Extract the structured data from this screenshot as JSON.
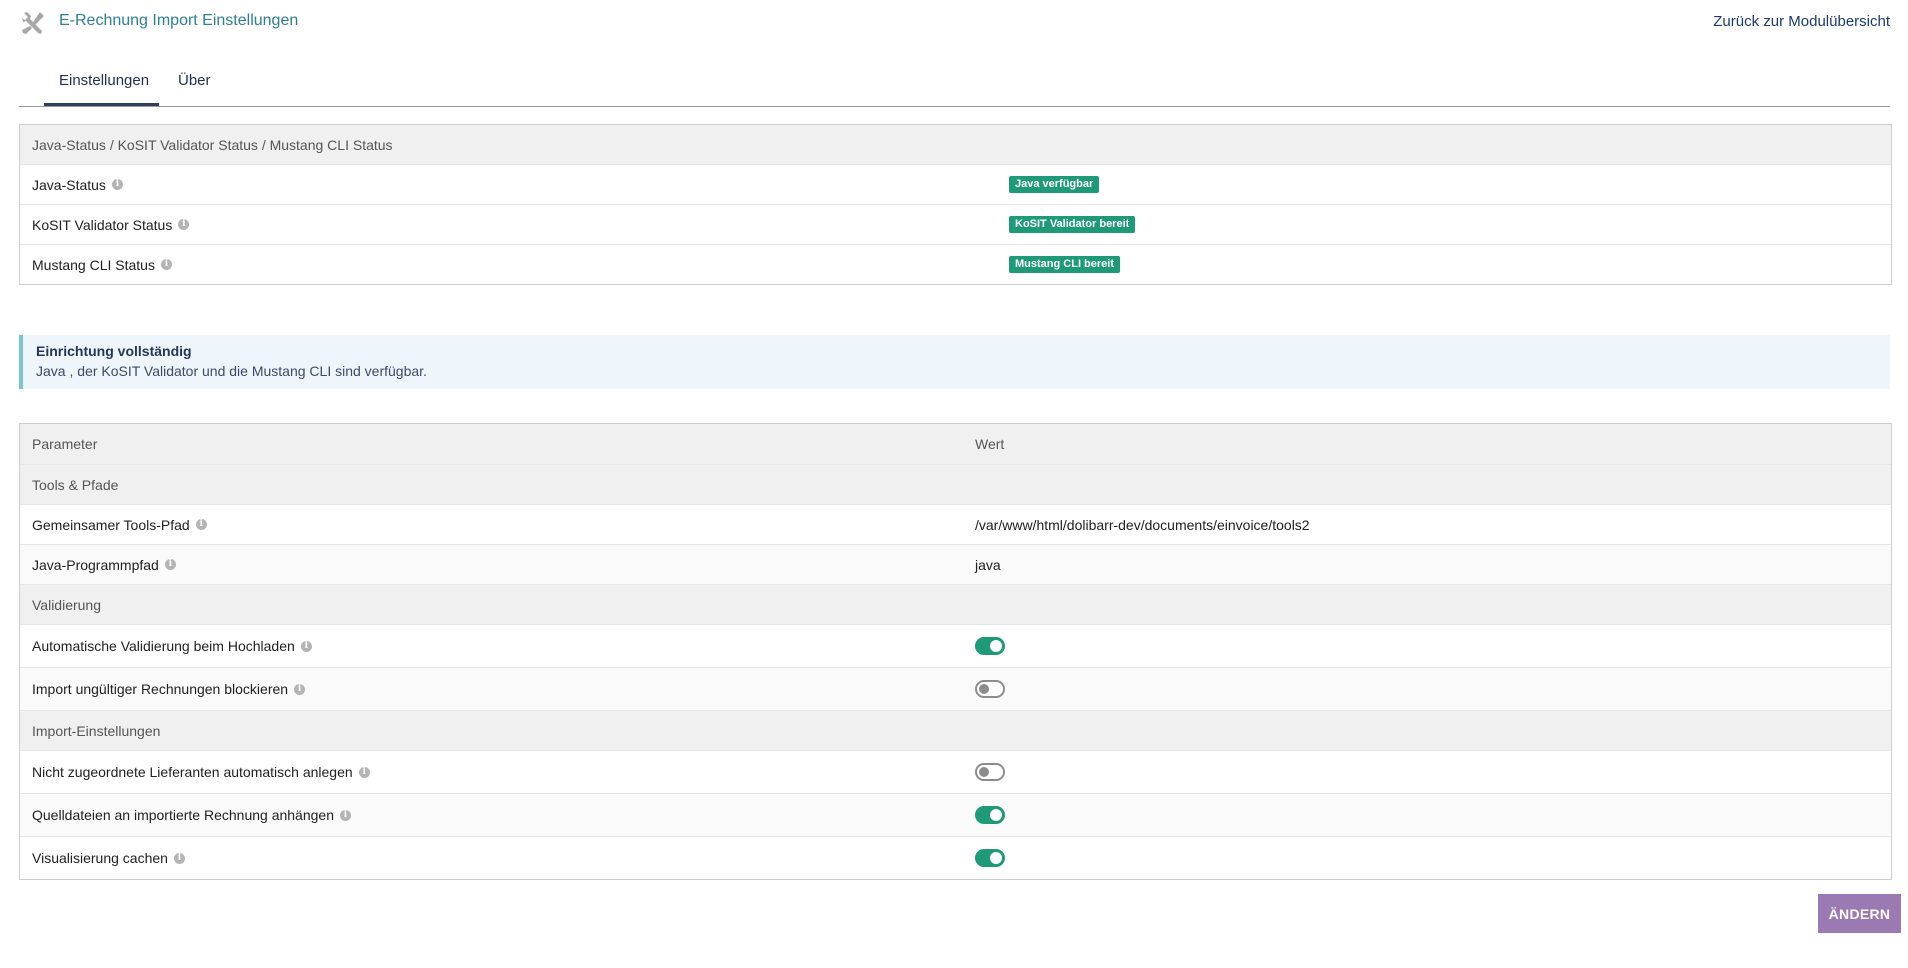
{
  "header": {
    "title": "E-Rechnung Import Einstellungen",
    "back_link": "Zurück zur Modulübersicht"
  },
  "tabs": [
    {
      "label": "Einstellungen",
      "active": true
    },
    {
      "label": "Über",
      "active": false
    }
  ],
  "status_table": {
    "heading": "Java-Status / KoSIT Validator Status / Mustang CLI Status",
    "rows": [
      {
        "label": "Java-Status",
        "badge": "Java verfügbar"
      },
      {
        "label": "KoSIT Validator Status",
        "badge": "KoSIT Validator bereit"
      },
      {
        "label": "Mustang CLI Status",
        "badge": "Mustang CLI bereit"
      }
    ]
  },
  "notice": {
    "title": "Einrichtung vollständig",
    "text": "Java , der KoSIT Validator und die Mustang CLI sind verfügbar."
  },
  "params_table": {
    "col_parameter": "Parameter",
    "col_value": "Wert",
    "sections": [
      {
        "title": "Tools & Pfade",
        "rows": [
          {
            "label": "Gemeinsamer Tools-Pfad",
            "value": "/var/www/html/dolibarr-dev/documents/einvoice/tools2"
          },
          {
            "label": "Java-Programmpfad",
            "value": "java"
          }
        ]
      },
      {
        "title": "Validierung",
        "rows": [
          {
            "label": "Automatische Validierung beim Hochladen",
            "toggle": true
          },
          {
            "label": "Import ungültiger Rechnungen blockieren",
            "toggle": false
          }
        ]
      },
      {
        "title": "Import-Einstellungen",
        "rows": [
          {
            "label": "Nicht zugeordnete Lieferanten automatisch anlegen",
            "toggle": false
          },
          {
            "label": "Quelldateien an importierte Rechnung anhängen",
            "toggle": true
          },
          {
            "label": "Visualisierung cachen",
            "toggle": true
          }
        ]
      }
    ]
  },
  "actions": {
    "modify_label": "ÄNDERN"
  },
  "colors": {
    "accent_green": "#1f9a79",
    "button_purple": "#9b79b2",
    "title_teal": "#2f7f94"
  }
}
